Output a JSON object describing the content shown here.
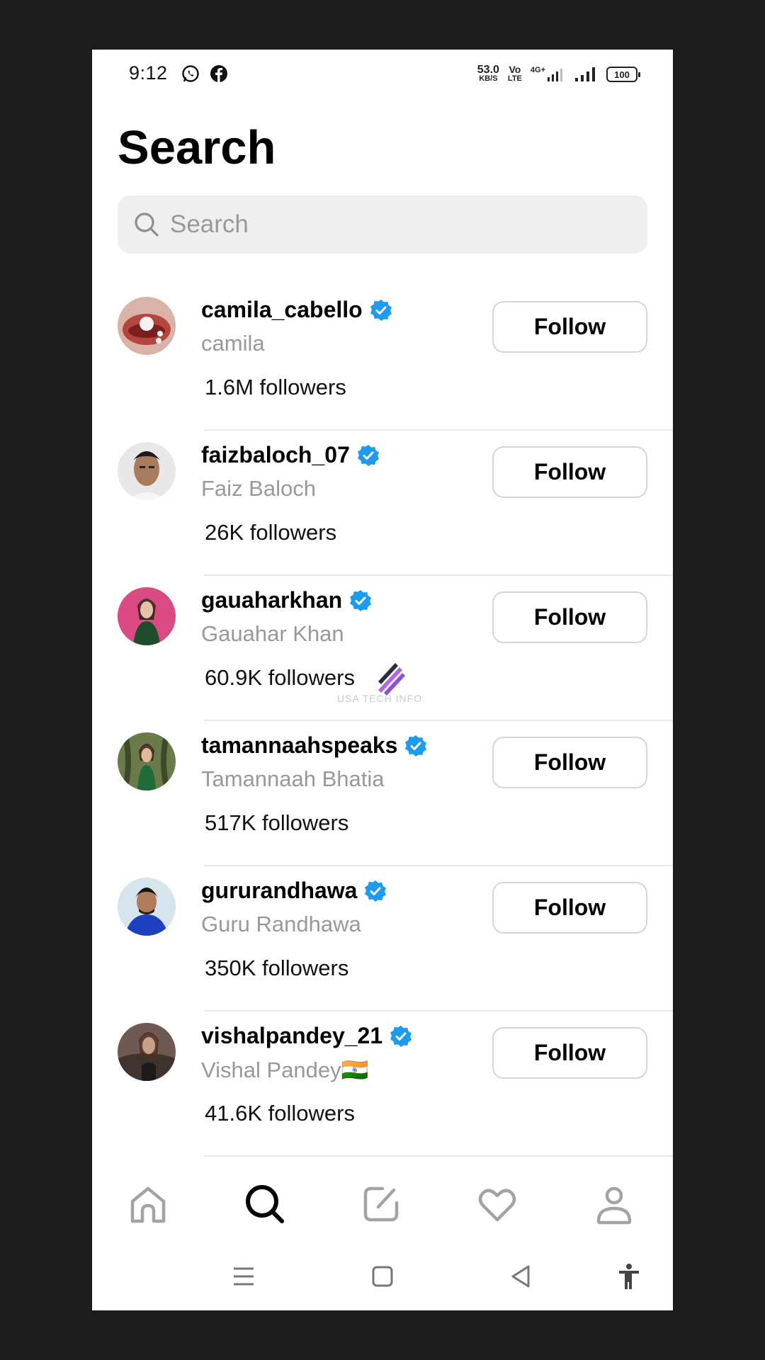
{
  "status_bar": {
    "time": "9:12",
    "net_speed_value": "53.0",
    "net_speed_unit": "KB/S",
    "volte_top": "Vo",
    "volte_bottom": "LTE",
    "network": "4G+",
    "battery": "100"
  },
  "page": {
    "title": "Search"
  },
  "search": {
    "placeholder": "Search",
    "value": ""
  },
  "users": [
    {
      "username": "camila_cabello",
      "full_name": "camila",
      "followers": "1.6M followers",
      "button": "Follow",
      "verified": true
    },
    {
      "username": "faizbaloch_07",
      "full_name": "Faiz Baloch",
      "followers": "26K followers",
      "button": "Follow",
      "verified": true
    },
    {
      "username": "gauaharkhan",
      "full_name": "Gauahar Khan",
      "followers": "60.9K followers",
      "button": "Follow",
      "verified": true
    },
    {
      "username": "tamannaahspeaks",
      "full_name": "Tamannaah Bhatia",
      "followers": "517K followers",
      "button": "Follow",
      "verified": true
    },
    {
      "username": "gururandhawa",
      "full_name": "Guru Randhawa",
      "followers": "350K followers",
      "button": "Follow",
      "verified": true
    },
    {
      "username": "vishalpandey_21",
      "full_name": "Vishal Pandey🇮🇳",
      "followers": "41.6K followers",
      "button": "Follow",
      "verified": true
    }
  ],
  "watermark": {
    "text": "USA TECH INFO"
  },
  "bottom_nav": [
    "home-icon",
    "search-icon",
    "compose-icon",
    "heart-icon",
    "profile-icon"
  ],
  "system_nav": [
    "menu-icon",
    "home-square-icon",
    "back-icon",
    "accessibility-icon"
  ],
  "colors": {
    "verified": "#1d9bf0",
    "muted_text": "#999999",
    "divider": "#e8e8e8"
  }
}
